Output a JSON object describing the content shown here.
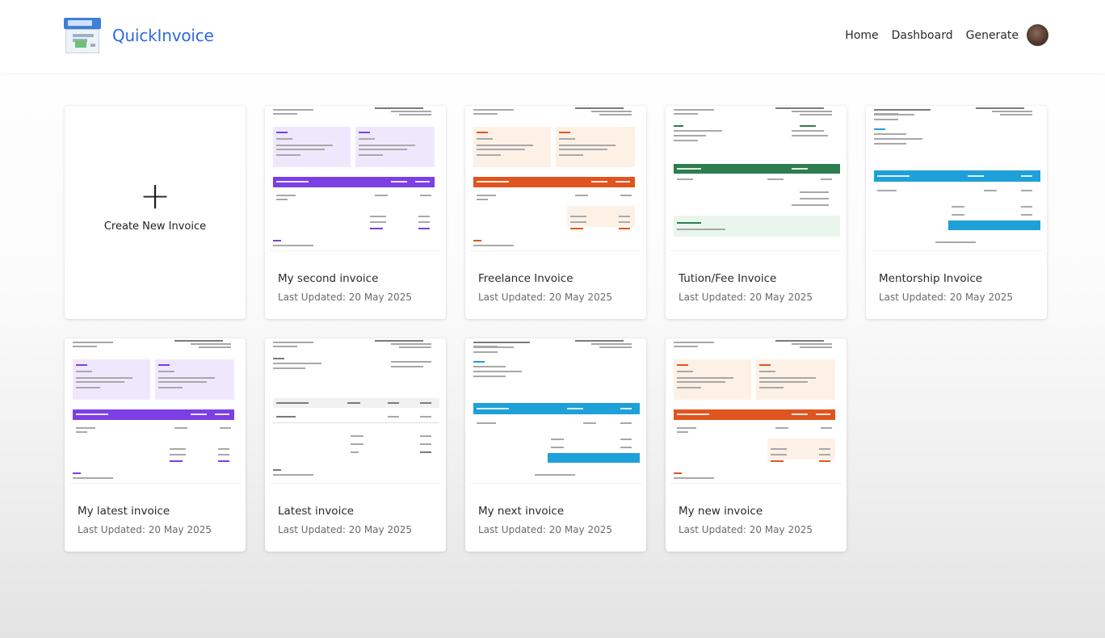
{
  "app": {
    "name": "QuickInvoice",
    "logo_label": "INVOICE",
    "brand_color": "#2d6be0"
  },
  "nav": {
    "links": [
      "Home",
      "Dashboard",
      "Generate"
    ],
    "avatar_icon": "user-avatar"
  },
  "create_card": {
    "icon": "plus-icon",
    "label": "Create New Invoice"
  },
  "invoices": [
    {
      "title": "My second invoice",
      "updated": "Last Updated: 20 May 2025",
      "theme": "purple",
      "accent": "#7b3fe4"
    },
    {
      "title": "Freelance Invoice",
      "updated": "Last Updated: 20 May 2025",
      "theme": "orange",
      "accent": "#e0541f"
    },
    {
      "title": "Tution/Fee Invoice",
      "updated": "Last Updated: 20 May 2025",
      "theme": "green",
      "accent": "#2e7d4f"
    },
    {
      "title": "Mentorship Invoice",
      "updated": "Last Updated: 20 May 2025",
      "theme": "blue",
      "accent": "#1ea0d8"
    },
    {
      "title": "My latest invoice",
      "updated": "Last Updated: 20 May 2025",
      "theme": "purple",
      "accent": "#7b3fe4"
    },
    {
      "title": "Latest invoice",
      "updated": "Last Updated: 20 May 2025",
      "theme": "plain",
      "accent": "#555555"
    },
    {
      "title": "My next invoice",
      "updated": "Last Updated: 20 May 2025",
      "theme": "blue",
      "accent": "#1ea0d8"
    },
    {
      "title": "My new invoice",
      "updated": "Last Updated: 20 May 2025",
      "theme": "orange",
      "accent": "#e0541f"
    }
  ]
}
